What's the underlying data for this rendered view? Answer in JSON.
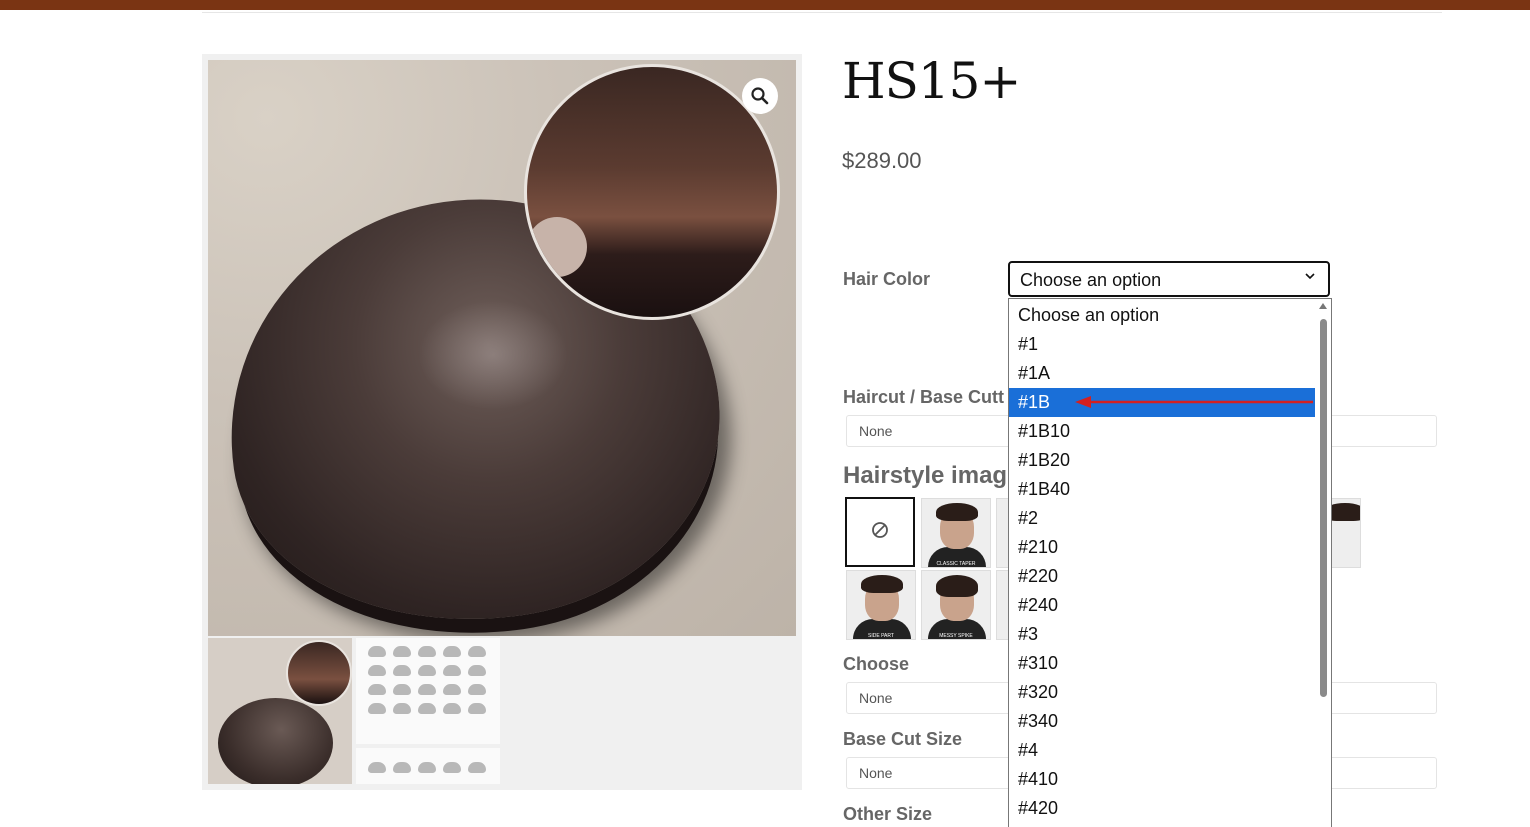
{
  "product": {
    "title": "HS15+",
    "price": "$289.00"
  },
  "gallery": {
    "zoom_icon": "magnifier-icon"
  },
  "form": {
    "hair_color_label": "Hair Color",
    "hair_color_value": "Choose an option",
    "haircut_label": "Haircut / Base Cutt",
    "haircut_value": "None",
    "hairstyle_heading": "Hairstyle imag",
    "choose_label": "Choose",
    "choose_value": "None",
    "base_cut_label": "Base Cut Size",
    "base_cut_value": "None",
    "other_size_label": "Other Size",
    "none_option_icon": "none-circle-slash-icon"
  },
  "hairstyles": [
    {
      "caption": "CLASSIC TAPER"
    },
    {
      "caption": "SIDE PART"
    },
    {
      "caption": "MESSY SPIKE"
    }
  ],
  "dropdown": {
    "options": [
      "Choose an option",
      "#1",
      "#1A",
      "#1B",
      "#1B10",
      "#1B20",
      "#1B40",
      "#2",
      "#210",
      "#220",
      "#240",
      "#3",
      "#310",
      "#320",
      "#340",
      "#4",
      "#410",
      "#420"
    ],
    "highlighted": "#1B",
    "highlight_color": "#1a6fd8",
    "annotation_arrow_color": "#d42020"
  },
  "colors": {
    "topbar": "#7a3413"
  }
}
